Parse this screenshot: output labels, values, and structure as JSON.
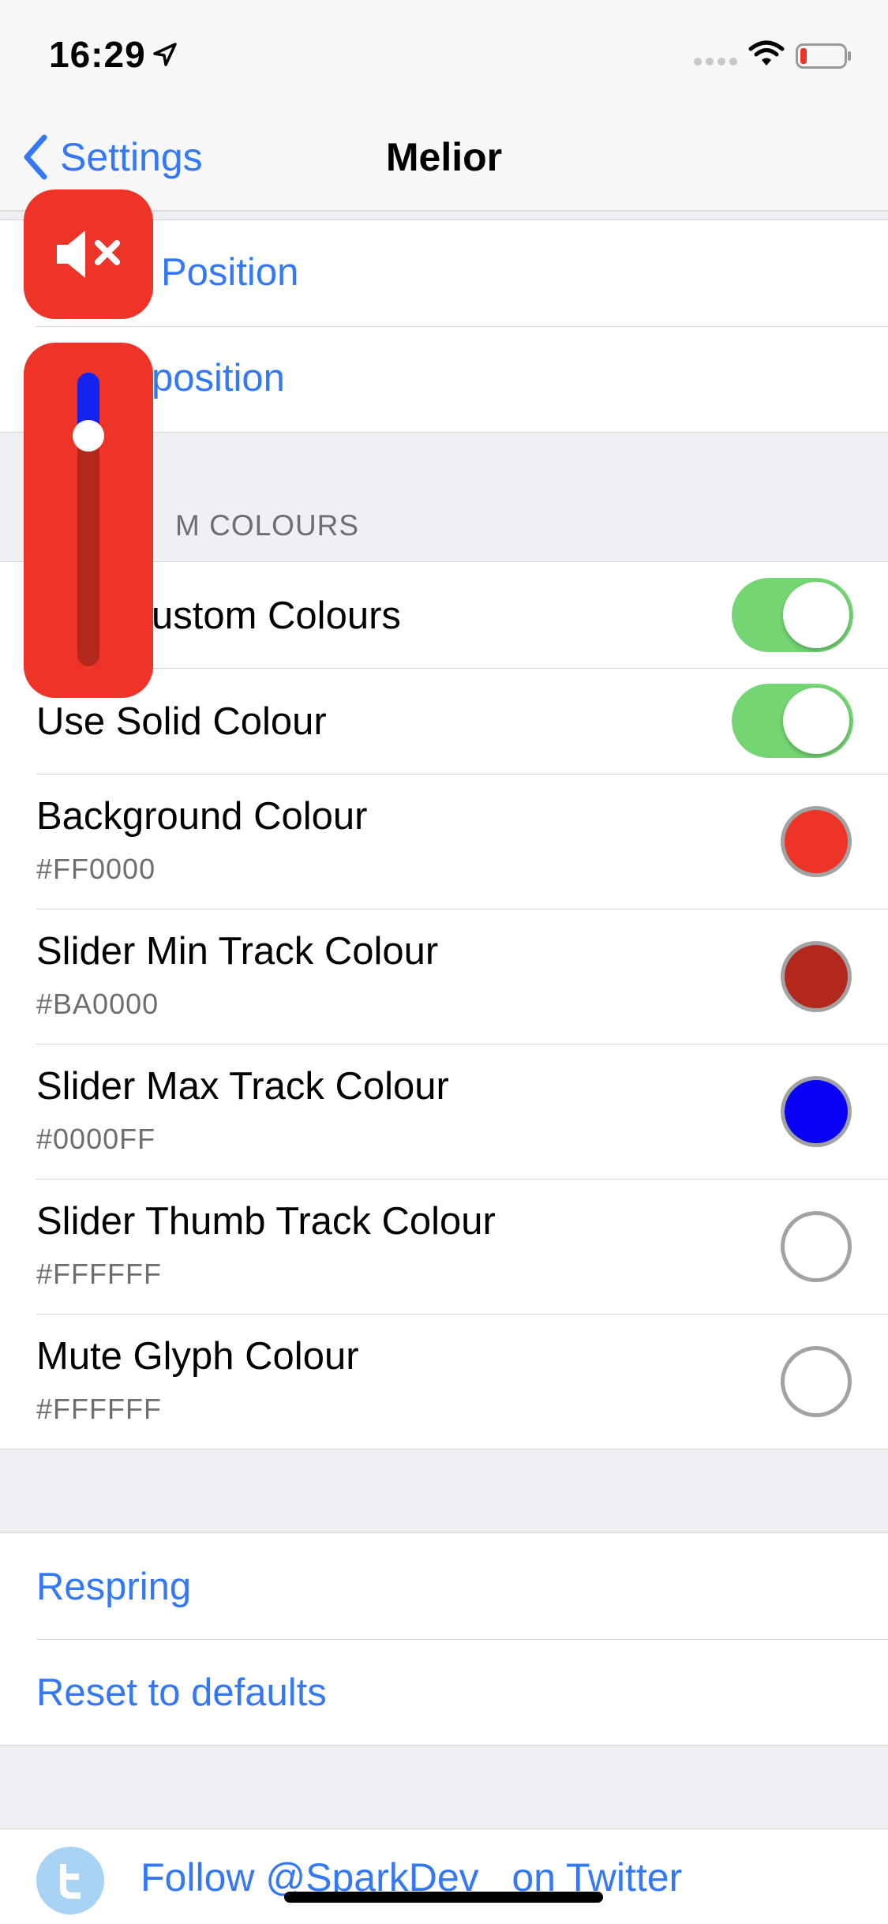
{
  "status_bar": {
    "time": "16:29"
  },
  "nav": {
    "back_label": "Settings",
    "title": "Melior"
  },
  "top_group": {
    "rows": [
      {
        "label": "Position"
      },
      {
        "label": "position"
      }
    ]
  },
  "custom_colours": {
    "header": "M COLOURS",
    "toggles": [
      {
        "label": "ustom Colours",
        "on": true
      },
      {
        "label": "Use Solid Colour",
        "on": true
      }
    ],
    "colour_rows": [
      {
        "label": "Background Colour",
        "value": "#FF0000",
        "swatch": "#ee3428"
      },
      {
        "label": "Slider Min Track Colour",
        "value": "#BA0000",
        "swatch": "#b2281d"
      },
      {
        "label": "Slider Max Track Colour",
        "value": "#0000FF",
        "swatch": "#0a00f5"
      },
      {
        "label": "Slider Thumb Track Colour",
        "value": "#FFFFFF",
        "swatch": "#ffffff"
      },
      {
        "label": "Mute Glyph Colour",
        "value": "#FFFFFF",
        "swatch": "#ffffff"
      }
    ]
  },
  "actions": {
    "respring": "Respring",
    "reset": "Reset to defaults"
  },
  "twitter": {
    "label": "Follow @SparkDev_ on Twitter",
    "icon": "twitter-icon"
  },
  "hud": {
    "mute_icon": "speaker-muted-icon",
    "slider_level": 0.16,
    "colors": {
      "background": "#ee3428",
      "min_track": "#1424ee",
      "max_track": "#b2281d",
      "thumb": "#ffffff"
    }
  }
}
